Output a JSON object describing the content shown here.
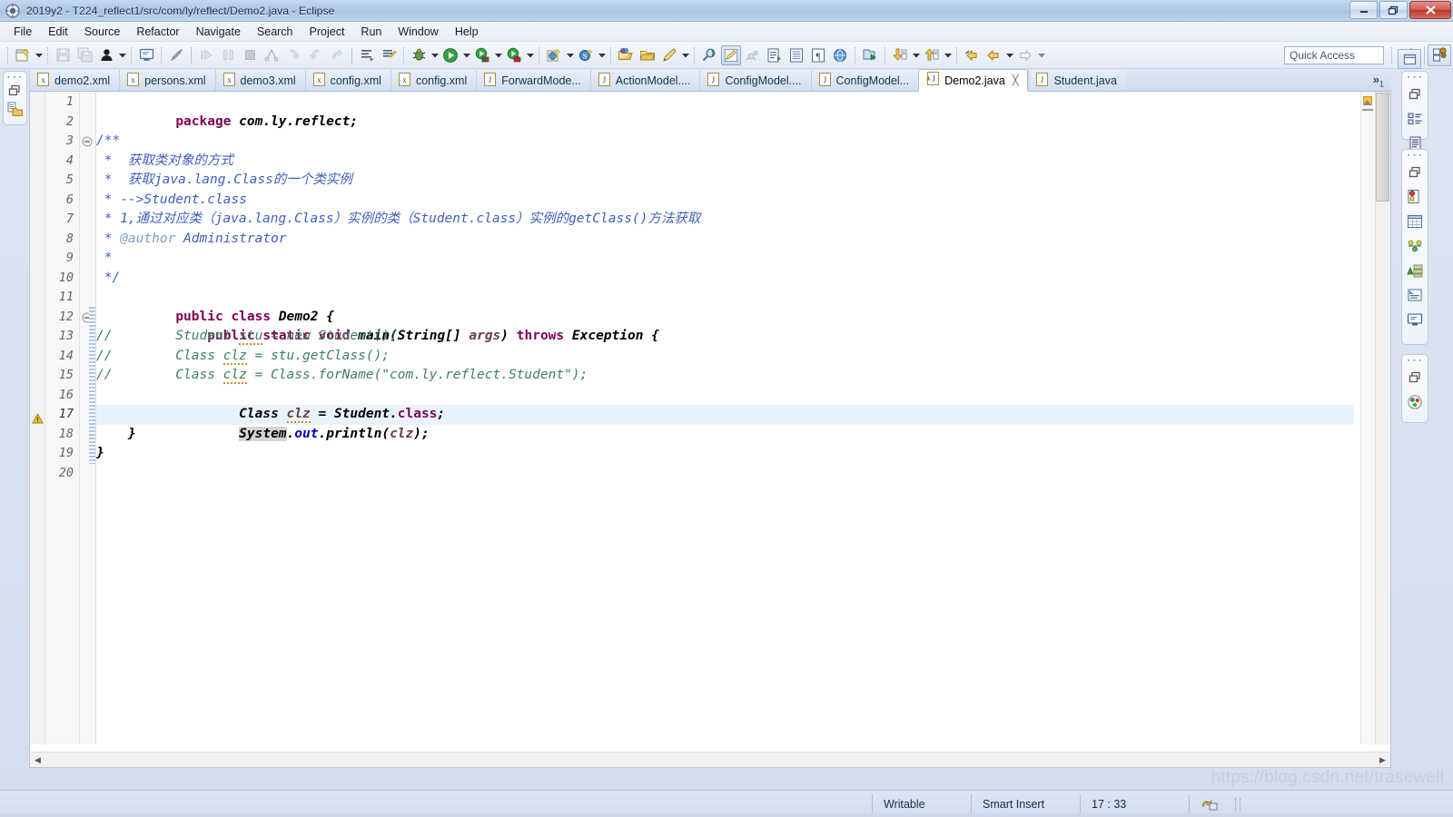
{
  "window": {
    "title": "2019y2 - T224_reflect1/src/com/ly/reflect/Demo2.java - Eclipse",
    "app_icon": "eclipse-icon",
    "minimize_label": "Minimize",
    "restore_label": "Restore",
    "close_label": "Close"
  },
  "menu": {
    "items": [
      {
        "label": "File"
      },
      {
        "label": "Edit"
      },
      {
        "label": "Source"
      },
      {
        "label": "Refactor"
      },
      {
        "label": "Navigate"
      },
      {
        "label": "Search"
      },
      {
        "label": "Project"
      },
      {
        "label": "Run"
      },
      {
        "label": "Window"
      },
      {
        "label": "Help"
      }
    ]
  },
  "toolbar": {
    "quick_access_text": "Quick Access",
    "buttons": [
      {
        "name": "new-wizard-icon",
        "kind": "new"
      },
      {
        "name": "new-dropdown-icon",
        "kind": "arrow"
      },
      {
        "name": "save-icon",
        "kind": "save"
      },
      {
        "name": "save-all-icon",
        "kind": "saveall"
      },
      {
        "name": "user-icon",
        "kind": "user"
      },
      {
        "name": "user-dropdown-icon",
        "kind": "arrow"
      },
      {
        "name": "console-icon",
        "kind": "console"
      },
      {
        "name": "skip-breakpoints-icon",
        "kind": "skipbp"
      },
      {
        "name": "resume-icon",
        "kind": "resume"
      },
      {
        "name": "suspend-icon",
        "kind": "suspend"
      },
      {
        "name": "terminate-icon",
        "kind": "terminate"
      },
      {
        "name": "disconnect-icon",
        "kind": "disconnect"
      },
      {
        "name": "step-into-icon",
        "kind": "stepinto"
      },
      {
        "name": "step-over-icon",
        "kind": "stepover"
      },
      {
        "name": "step-return-icon",
        "kind": "stepreturn"
      },
      {
        "name": "last-edit-location-icon",
        "kind": "lastedit"
      },
      {
        "name": "next-annotation-icon",
        "kind": "nextanno"
      },
      {
        "name": "debug-icon",
        "kind": "debug"
      },
      {
        "name": "debug-dropdown-icon",
        "kind": "arrow"
      },
      {
        "name": "run-icon",
        "kind": "run"
      },
      {
        "name": "run-dropdown-icon",
        "kind": "arrow"
      },
      {
        "name": "run-external-icon",
        "kind": "runext"
      },
      {
        "name": "run-external-dropdown-icon",
        "kind": "arrow"
      },
      {
        "name": "coverage-icon",
        "kind": "coverage"
      },
      {
        "name": "coverage-dropdown-icon",
        "kind": "arrow"
      },
      {
        "name": "new-java-project-icon",
        "kind": "newjavaproj"
      },
      {
        "name": "new-java-project-dropdown-icon",
        "kind": "arrow"
      },
      {
        "name": "new-spring-icon",
        "kind": "spring"
      },
      {
        "name": "new-spring-dropdown-icon",
        "kind": "arrow"
      },
      {
        "name": "open-type-icon",
        "kind": "opentype"
      },
      {
        "name": "open-task-icon",
        "kind": "opentask"
      },
      {
        "name": "new-annotation-icon",
        "kind": "pencil"
      },
      {
        "name": "pencil-dropdown-icon",
        "kind": "arrow"
      },
      {
        "name": "search-icon",
        "kind": "searchg"
      },
      {
        "name": "toggle-markoccurrence-icon",
        "kind": "markocc"
      },
      {
        "name": "toggle-ant-icon",
        "kind": "ant"
      },
      {
        "name": "open-task-list-icon",
        "kind": "tasklist"
      },
      {
        "name": "show-whitespace-icon",
        "kind": "whitespace"
      },
      {
        "name": "block-selection-icon",
        "kind": "blocksel"
      },
      {
        "name": "open-web-browser-icon",
        "kind": "browser"
      },
      {
        "name": "deploy-icon",
        "kind": "deploy"
      },
      {
        "name": "download-icon",
        "kind": "download"
      },
      {
        "name": "download-dropdown-icon",
        "kind": "arrow"
      },
      {
        "name": "upload-icon",
        "kind": "upload"
      },
      {
        "name": "upload-dropdown-icon",
        "kind": "arrow"
      },
      {
        "name": "back-icon",
        "kind": "back"
      },
      {
        "name": "forward-icon",
        "kind": "forward"
      },
      {
        "name": "forward-dropdown-icon",
        "kind": "arrow"
      },
      {
        "name": "next-icon",
        "kind": "next"
      },
      {
        "name": "next-dropdown-icon",
        "kind": "arrow"
      }
    ],
    "perspective": {
      "open_perspective_icon": "open-perspective-icon",
      "java_perspective_icon": "java-perspective-icon"
    }
  },
  "left_fastview": {
    "restore_icon": "restore-view-icon",
    "package_explorer_icon": "package-explorer-icon"
  },
  "right_fastview": {
    "groups": [
      {
        "restore_icon": "restore-view-icon",
        "items": [
          {
            "name": "outline-icon"
          },
          {
            "name": "task-list-icon"
          }
        ]
      },
      {
        "restore_icon": "restore-view-icon",
        "items": [
          {
            "name": "breakpoints-icon"
          },
          {
            "name": "variables-table-icon"
          },
          {
            "name": "expressions-icon"
          },
          {
            "name": "servers-icon"
          },
          {
            "name": "snippets-icon"
          },
          {
            "name": "console-view-icon"
          }
        ]
      },
      {
        "restore_icon": "restore-view-icon",
        "items": [
          {
            "name": "progress-icon"
          }
        ]
      }
    ]
  },
  "editor": {
    "tabs": [
      {
        "label": "demo2.xml",
        "icon": "xml-file-icon",
        "active": false,
        "dirty": false
      },
      {
        "label": "persons.xml",
        "icon": "xml-file-icon",
        "active": false,
        "dirty": false
      },
      {
        "label": "demo3.xml",
        "icon": "xml-file-icon",
        "active": false,
        "dirty": false
      },
      {
        "label": "config.xml",
        "icon": "xml-file-icon",
        "active": false,
        "dirty": false
      },
      {
        "label": "config.xml",
        "icon": "xml-file-icon",
        "active": false,
        "dirty": false
      },
      {
        "label": "ForwardMode...",
        "icon": "java-file-icon",
        "active": false,
        "dirty": false
      },
      {
        "label": "ActionModel....",
        "icon": "java-file-icon",
        "active": false,
        "dirty": false
      },
      {
        "label": "ConfigModel....",
        "icon": "java-file-icon",
        "active": false,
        "dirty": false
      },
      {
        "label": "ConfigModel...",
        "icon": "java-file-icon",
        "active": false,
        "dirty": false
      },
      {
        "label": "Demo2.java",
        "icon": "java-file-warning-icon",
        "active": true,
        "dirty": false,
        "close_glyph": "╳"
      },
      {
        "label": "Student.java",
        "icon": "java-file-icon",
        "active": false,
        "dirty": false
      }
    ],
    "more_tabs_glyph": "»",
    "more_tabs_count": "1",
    "current_line": 17,
    "warning_line": 16,
    "folding_lines": [
      3,
      12
    ],
    "lines": [
      {
        "n": 1,
        "text": "package com.ly.reflect;"
      },
      {
        "n": 2,
        "text": ""
      },
      {
        "n": 3,
        "text": "/**"
      },
      {
        "n": 4,
        "text": " *  获取类对象的方式"
      },
      {
        "n": 5,
        "text": " *  获取java.lang.Class的一个类实例"
      },
      {
        "n": 6,
        "text": " * -->Student.class"
      },
      {
        "n": 7,
        "text": " * 1,通过对应类（java.lang.Class）实例的类（Student.class）实例的getClass()方法获取"
      },
      {
        "n": 8,
        "text": " * @author Administrator"
      },
      {
        "n": 9,
        "text": " *"
      },
      {
        "n": 10,
        "text": " */"
      },
      {
        "n": 11,
        "text": "public class Demo2 {"
      },
      {
        "n": 12,
        "text": "    public static void main(String[] args) throws Exception {"
      },
      {
        "n": 13,
        "text": "//        Student stu = new Student();"
      },
      {
        "n": 14,
        "text": "//        Class clz = stu.getClass();"
      },
      {
        "n": 15,
        "text": "//        Class clz = Class.forName(\"com.ly.reflect.Student\");"
      },
      {
        "n": 16,
        "text": "        Class clz = Student.class;"
      },
      {
        "n": 17,
        "text": "        System.out.println(clz);"
      },
      {
        "n": 18,
        "text": "    }"
      },
      {
        "n": 19,
        "text": "}"
      },
      {
        "n": 20,
        "text": ""
      }
    ]
  },
  "status": {
    "writable": "Writable",
    "insert_mode": "Smart Insert",
    "position": "17 : 33",
    "sync_icon": "link-with-editor-icon"
  },
  "watermark": "https://blog.csdn.net/trasewell",
  "colors": {
    "keyword": "#7f0055",
    "comment": "#3f7f5f",
    "javadoc": "#3f5fbf",
    "javadoc_tag": "#7f9fbf",
    "string": "#2a00ff",
    "field": "#0000c0",
    "local_var": "#6a3e3e",
    "current_line_bg": "#e8f2fd",
    "accent": "#3f5fbf"
  }
}
